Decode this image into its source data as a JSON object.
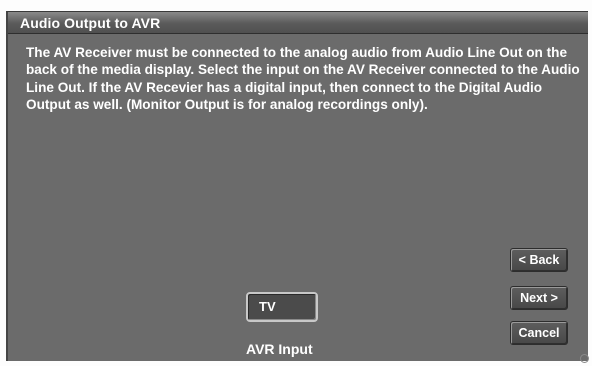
{
  "window": {
    "title": "Audio Output to AVR"
  },
  "instructions": "The AV Receiver must be connected to the analog audio from Audio Line Out on the back of the media display.  Select the input on the AV Receiver connected to the Audio Line Out.  If the AV Recevier has a digital input, then connect to the Digital Audio Output as well.  (Monitor Output is for analog recordings only).",
  "avr_input": {
    "selected_value": "TV",
    "label": "AVR Input"
  },
  "buttons": {
    "back": "< Back",
    "next": "Next >",
    "cancel": "Cancel"
  },
  "colors": {
    "panel_background": "#6b6b6b",
    "title_bar": "#5a5a5a",
    "text": "#ffffff"
  }
}
